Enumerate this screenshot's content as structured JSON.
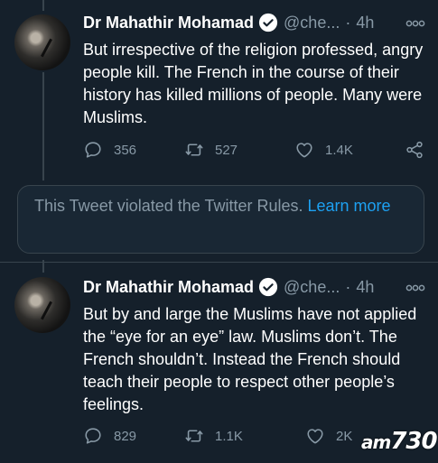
{
  "tweets": [
    {
      "author_name": "Dr Mahathir Mohamad",
      "handle": "@che...",
      "separator": "·",
      "time": "4h",
      "text": "But irrespective of the religion professed, angry people kill. The French in the course of their history has killed millions of people. Many were Muslims.",
      "replies": "356",
      "retweets": "527",
      "likes": "1.4K"
    },
    {
      "author_name": "Dr Mahathir Mohamad",
      "handle": "@che...",
      "separator": "·",
      "time": "4h",
      "text": "But by and large the Muslims have not applied the “eye for an eye” law. Muslims don’t. The French shouldn’t. Instead the French should teach their people to respect other people’s feelings.",
      "replies": "829",
      "retweets": "1.1K",
      "likes": "2K"
    }
  ],
  "notice": {
    "text": "This Tweet violated the Twitter Rules.",
    "link": "Learn more"
  },
  "watermark": {
    "prefix": "am",
    "number": "730"
  },
  "colors": {
    "background": "#15202b",
    "secondary_text": "#8899a6",
    "link": "#1da1f2",
    "border": "#38444d"
  },
  "icons": [
    "verified-badge-icon",
    "more-dots-icon",
    "reply-icon",
    "retweet-icon",
    "like-icon",
    "share-icon"
  ]
}
